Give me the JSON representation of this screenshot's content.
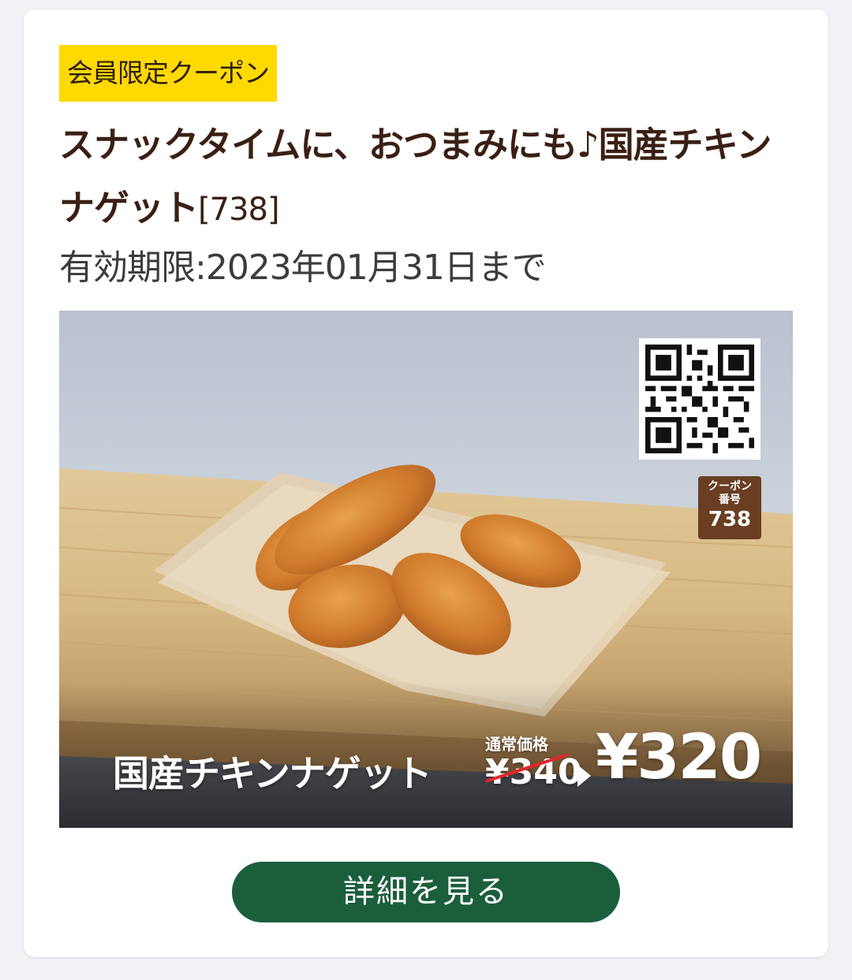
{
  "coupon": {
    "badge": "会員限定クーポン",
    "title": "スナックタイムに、おつまみにも♪国産チキンナゲット",
    "code": "[738]",
    "validity": "有効期限:2023年01月31日まで"
  },
  "image": {
    "coupon_number_label_1": "クーポン",
    "coupon_number_label_2": "番号",
    "coupon_number": "738",
    "product_name": "国産チキンナゲット",
    "regular_price_label": "通常価格",
    "regular_price": "¥340",
    "sale_price": "¥320"
  },
  "actions": {
    "detail_label": "詳細を見る"
  },
  "colors": {
    "badge_bg": "#ffd900",
    "title_text": "#3a1f14",
    "button_bg": "#1b5e3c",
    "coupon_number_bg": "#6a3e22",
    "strike_line": "#e2262b"
  },
  "icons": {
    "qr": "qr-code-icon",
    "arrow": "triangle-right-icon"
  }
}
